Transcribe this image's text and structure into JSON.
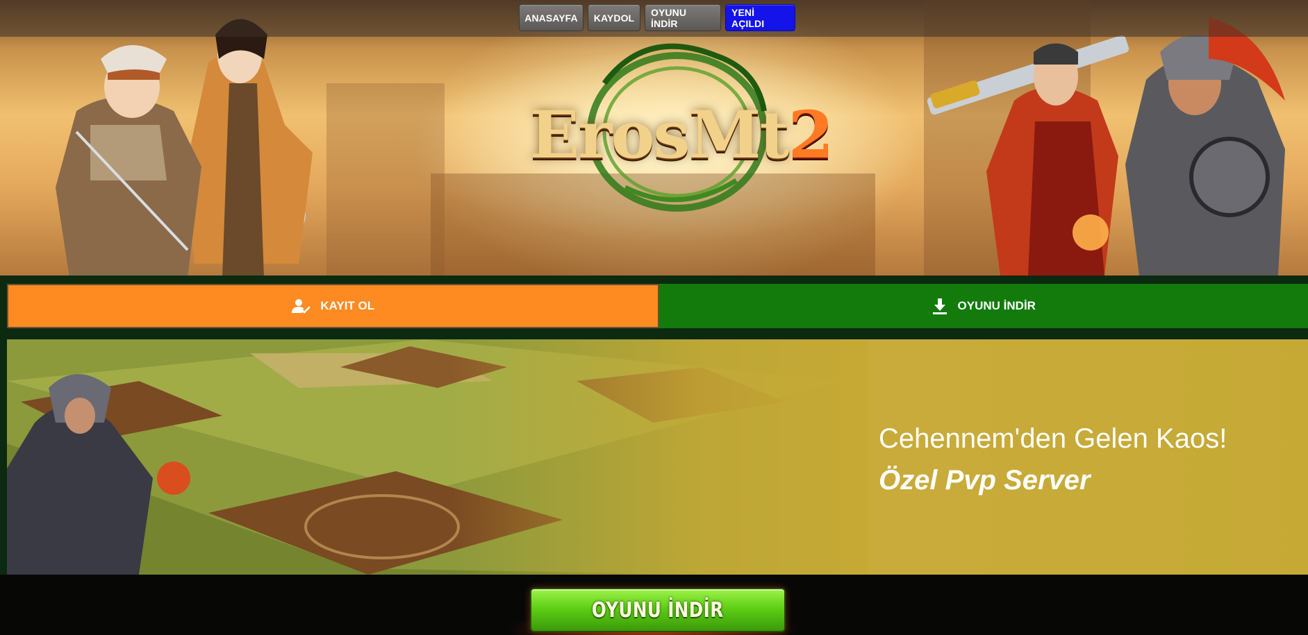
{
  "nav": {
    "items": [
      {
        "label": "ANASAYFA"
      },
      {
        "label": "KAYDOL"
      },
      {
        "label": "OYUNU İNDİR"
      },
      {
        "label": "YENİ AÇILDI"
      }
    ]
  },
  "logo": {
    "text_main": "ErosMt",
    "text_num": "2"
  },
  "actions": {
    "register_label": "KAYIT OL",
    "download_label": "OYUNU İNDİR"
  },
  "banner": {
    "title": "Cehennem'den Gelen Kaos!",
    "subtitle": "Özel Pvp Server"
  },
  "bottom": {
    "download_button_label": "OYUNU İNDİR"
  },
  "colors": {
    "register": "#fd8b22",
    "download": "#127b0c",
    "new_badge": "#1313ea",
    "banner_bg": "#c6a935"
  },
  "icons": [
    "user-check-icon",
    "download-icon"
  ]
}
